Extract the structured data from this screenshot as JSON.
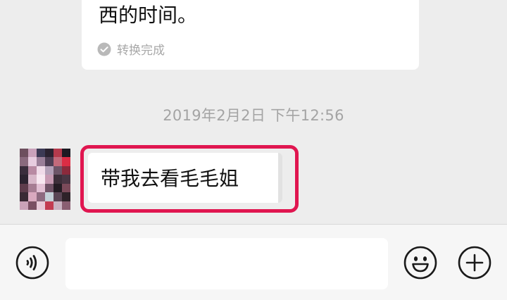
{
  "chat": {
    "previous_message": {
      "text": "西的时间。",
      "status_text": "转换完成",
      "status_icon": "check-circle-icon"
    },
    "timestamp": "2019年2月2日 下午12:56",
    "message": {
      "text": "带我去看毛毛姐",
      "avatar": "pixelated-avatar",
      "highlight_color": "#e01650"
    }
  },
  "input_bar": {
    "voice_icon": "voice-icon",
    "input_value": "",
    "input_placeholder": "",
    "emoji_icon": "emoji-icon",
    "plus_icon": "plus-icon"
  },
  "colors": {
    "chat_background": "#ededed",
    "bubble": "#ffffff",
    "highlight": "#e01650",
    "timestamp_text": "#a4a4a4",
    "input_bar_background": "#f6f6f6"
  }
}
